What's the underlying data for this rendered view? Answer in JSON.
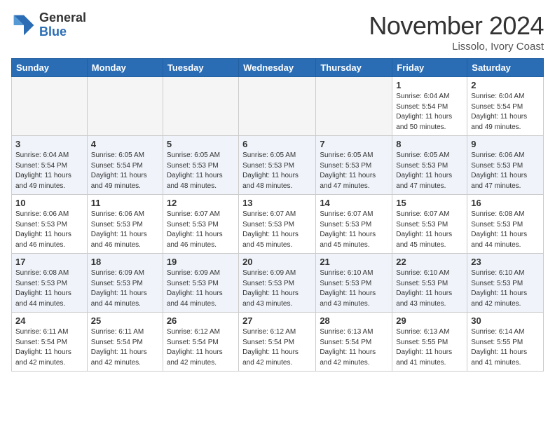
{
  "header": {
    "logo_general": "General",
    "logo_blue": "Blue",
    "month_title": "November 2024",
    "location": "Lissolo, Ivory Coast"
  },
  "weekdays": [
    "Sunday",
    "Monday",
    "Tuesday",
    "Wednesday",
    "Thursday",
    "Friday",
    "Saturday"
  ],
  "weeks": [
    [
      {
        "day": "",
        "empty": true
      },
      {
        "day": "",
        "empty": true
      },
      {
        "day": "",
        "empty": true
      },
      {
        "day": "",
        "empty": true
      },
      {
        "day": "",
        "empty": true
      },
      {
        "day": "1",
        "sunrise": "6:04 AM",
        "sunset": "5:54 PM",
        "daylight": "11 hours and 50 minutes."
      },
      {
        "day": "2",
        "sunrise": "6:04 AM",
        "sunset": "5:54 PM",
        "daylight": "11 hours and 49 minutes."
      }
    ],
    [
      {
        "day": "3",
        "sunrise": "6:04 AM",
        "sunset": "5:54 PM",
        "daylight": "11 hours and 49 minutes."
      },
      {
        "day": "4",
        "sunrise": "6:05 AM",
        "sunset": "5:54 PM",
        "daylight": "11 hours and 49 minutes."
      },
      {
        "day": "5",
        "sunrise": "6:05 AM",
        "sunset": "5:53 PM",
        "daylight": "11 hours and 48 minutes."
      },
      {
        "day": "6",
        "sunrise": "6:05 AM",
        "sunset": "5:53 PM",
        "daylight": "11 hours and 48 minutes."
      },
      {
        "day": "7",
        "sunrise": "6:05 AM",
        "sunset": "5:53 PM",
        "daylight": "11 hours and 47 minutes."
      },
      {
        "day": "8",
        "sunrise": "6:05 AM",
        "sunset": "5:53 PM",
        "daylight": "11 hours and 47 minutes."
      },
      {
        "day": "9",
        "sunrise": "6:06 AM",
        "sunset": "5:53 PM",
        "daylight": "11 hours and 47 minutes."
      }
    ],
    [
      {
        "day": "10",
        "sunrise": "6:06 AM",
        "sunset": "5:53 PM",
        "daylight": "11 hours and 46 minutes."
      },
      {
        "day": "11",
        "sunrise": "6:06 AM",
        "sunset": "5:53 PM",
        "daylight": "11 hours and 46 minutes."
      },
      {
        "day": "12",
        "sunrise": "6:07 AM",
        "sunset": "5:53 PM",
        "daylight": "11 hours and 46 minutes."
      },
      {
        "day": "13",
        "sunrise": "6:07 AM",
        "sunset": "5:53 PM",
        "daylight": "11 hours and 45 minutes."
      },
      {
        "day": "14",
        "sunrise": "6:07 AM",
        "sunset": "5:53 PM",
        "daylight": "11 hours and 45 minutes."
      },
      {
        "day": "15",
        "sunrise": "6:07 AM",
        "sunset": "5:53 PM",
        "daylight": "11 hours and 45 minutes."
      },
      {
        "day": "16",
        "sunrise": "6:08 AM",
        "sunset": "5:53 PM",
        "daylight": "11 hours and 44 minutes."
      }
    ],
    [
      {
        "day": "17",
        "sunrise": "6:08 AM",
        "sunset": "5:53 PM",
        "daylight": "11 hours and 44 minutes."
      },
      {
        "day": "18",
        "sunrise": "6:09 AM",
        "sunset": "5:53 PM",
        "daylight": "11 hours and 44 minutes."
      },
      {
        "day": "19",
        "sunrise": "6:09 AM",
        "sunset": "5:53 PM",
        "daylight": "11 hours and 44 minutes."
      },
      {
        "day": "20",
        "sunrise": "6:09 AM",
        "sunset": "5:53 PM",
        "daylight": "11 hours and 43 minutes."
      },
      {
        "day": "21",
        "sunrise": "6:10 AM",
        "sunset": "5:53 PM",
        "daylight": "11 hours and 43 minutes."
      },
      {
        "day": "22",
        "sunrise": "6:10 AM",
        "sunset": "5:53 PM",
        "daylight": "11 hours and 43 minutes."
      },
      {
        "day": "23",
        "sunrise": "6:10 AM",
        "sunset": "5:53 PM",
        "daylight": "11 hours and 42 minutes."
      }
    ],
    [
      {
        "day": "24",
        "sunrise": "6:11 AM",
        "sunset": "5:54 PM",
        "daylight": "11 hours and 42 minutes."
      },
      {
        "day": "25",
        "sunrise": "6:11 AM",
        "sunset": "5:54 PM",
        "daylight": "11 hours and 42 minutes."
      },
      {
        "day": "26",
        "sunrise": "6:12 AM",
        "sunset": "5:54 PM",
        "daylight": "11 hours and 42 minutes."
      },
      {
        "day": "27",
        "sunrise": "6:12 AM",
        "sunset": "5:54 PM",
        "daylight": "11 hours and 42 minutes."
      },
      {
        "day": "28",
        "sunrise": "6:13 AM",
        "sunset": "5:54 PM",
        "daylight": "11 hours and 42 minutes."
      },
      {
        "day": "29",
        "sunrise": "6:13 AM",
        "sunset": "5:55 PM",
        "daylight": "11 hours and 41 minutes."
      },
      {
        "day": "30",
        "sunrise": "6:14 AM",
        "sunset": "5:55 PM",
        "daylight": "11 hours and 41 minutes."
      }
    ]
  ]
}
